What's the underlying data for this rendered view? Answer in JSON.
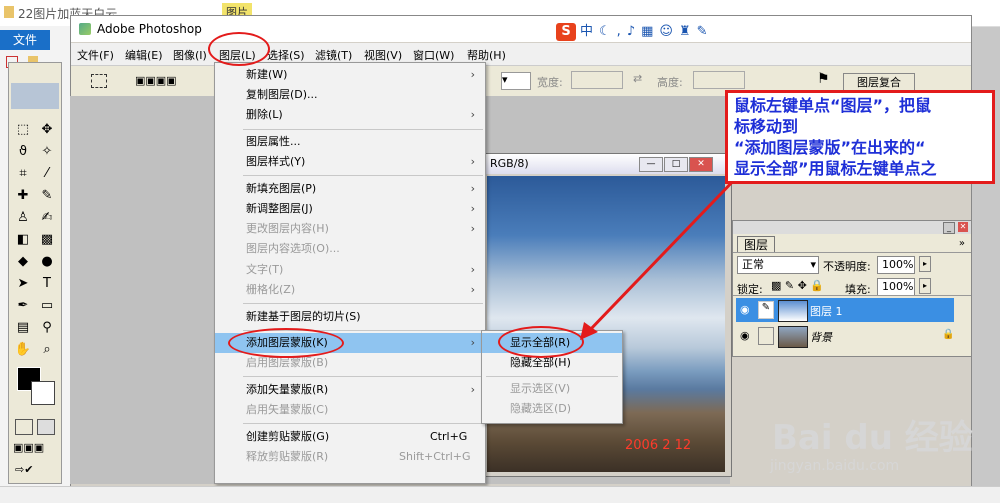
{
  "explorer": {
    "title": "22图片加蓝天白云",
    "tab2": "图片工具",
    "file_btn": "文件"
  },
  "app": {
    "title": "Adobe Photoshop"
  },
  "menubar": [
    {
      "label": "文件(F)"
    },
    {
      "label": "编辑(E)"
    },
    {
      "label": "图像(I)"
    },
    {
      "label": "图层(L)"
    },
    {
      "label": "选择(S)"
    },
    {
      "label": "滤镜(T)"
    },
    {
      "label": "视图(V)"
    },
    {
      "label": "窗口(W)"
    },
    {
      "label": "帮助(H)"
    }
  ],
  "ime": {
    "logo": "S",
    "mode": "中"
  },
  "options_bar": {
    "width_label": "宽度:",
    "height_label": "高度:"
  },
  "image_window": {
    "title": "RGB/8)",
    "date": "2006  2  12"
  },
  "panels": {
    "top_tab": "图层复合"
  },
  "layers_panel": {
    "tab": "图层",
    "blend_mode": "正常",
    "opacity_label": "不透明度:",
    "opacity_value": "100%",
    "lock_label": "锁定:",
    "fill_label": "填充:",
    "fill_value": "100%",
    "layers": [
      {
        "name": "图层 1"
      },
      {
        "name": "背景"
      }
    ]
  },
  "annotation": {
    "line1": "鼠标左键单点“图层”，把鼠",
    "line2": "标移动到",
    "line3": "“添加图层蒙版”在出来的“",
    "line4": "显示全部”用鼠标左键单点之"
  },
  "layer_menu": [
    {
      "label": "新建(W)",
      "arrow": "›"
    },
    {
      "label": "复制图层(D)..."
    },
    {
      "label": "删除(L)",
      "arrow": "›"
    },
    {
      "label": "图层属性..."
    },
    {
      "label": "图层样式(Y)",
      "arrow": "›"
    },
    {
      "label": "新填充图层(P)",
      "arrow": "›"
    },
    {
      "label": "新调整图层(J)",
      "arrow": "›"
    },
    {
      "label": "更改图层内容(H)",
      "arrow": "›"
    },
    {
      "label": "图层内容选项(O)..."
    },
    {
      "label": "文字(T)",
      "arrow": "›"
    },
    {
      "label": "栅格化(Z)",
      "arrow": "›"
    },
    {
      "label": "新建基于图层的切片(S)"
    },
    {
      "label": "添加图层蒙版(K)",
      "arrow": "›"
    },
    {
      "label": "启用图层蒙版(B)"
    },
    {
      "label": "添加矢量蒙版(R)",
      "arrow": "›"
    },
    {
      "label": "启用矢量蒙版(C)"
    },
    {
      "label": "创建剪贴蒙版(G)",
      "shortcut": "Ctrl+G"
    },
    {
      "label": "释放剪贴蒙版(R)",
      "shortcut": "Shift+Ctrl+G"
    }
  ],
  "mask_submenu": [
    {
      "label": "显示全部(R)"
    },
    {
      "label": "隐藏全部(H)"
    },
    {
      "label": "显示选区(V)"
    },
    {
      "label": "隐藏选区(D)"
    }
  ],
  "watermark": {
    "brand": "Bai du 经验",
    "url": "jingyan.baidu.com"
  }
}
